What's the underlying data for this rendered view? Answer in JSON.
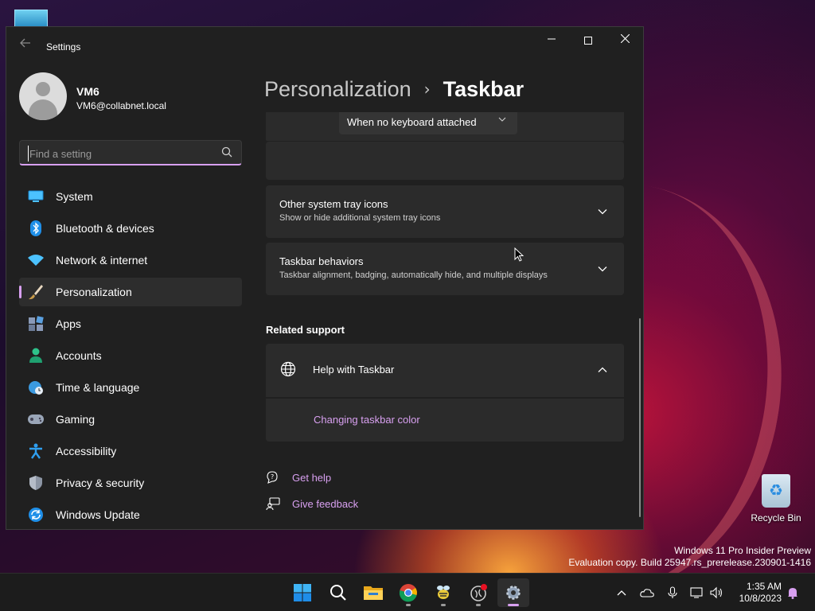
{
  "desktop": {
    "recycle_bin_label": "Recycle Bin",
    "watermark_line1": "Windows 11 Pro Insider Preview",
    "watermark_line2": "Evaluation copy. Build 25947.rs_prerelease.230901-1416"
  },
  "window": {
    "title": "Settings",
    "controls": [
      "minimize",
      "maximize",
      "close"
    ]
  },
  "profile": {
    "name": "VM6",
    "email": "VM6@collabnet.local"
  },
  "search": {
    "placeholder": "Find a setting",
    "value": ""
  },
  "sidebar": {
    "items": [
      {
        "label": "System",
        "icon": "monitor-icon",
        "active": false
      },
      {
        "label": "Bluetooth & devices",
        "icon": "bluetooth-icon",
        "active": false
      },
      {
        "label": "Network & internet",
        "icon": "wifi-icon",
        "active": false
      },
      {
        "label": "Personalization",
        "icon": "brush-icon",
        "active": true
      },
      {
        "label": "Apps",
        "icon": "apps-icon",
        "active": false
      },
      {
        "label": "Accounts",
        "icon": "person-icon",
        "active": false
      },
      {
        "label": "Time & language",
        "icon": "globe-clock-icon",
        "active": false
      },
      {
        "label": "Gaming",
        "icon": "gamepad-icon",
        "active": false
      },
      {
        "label": "Accessibility",
        "icon": "accessibility-icon",
        "active": false
      },
      {
        "label": "Privacy & security",
        "icon": "shield-icon",
        "active": false
      },
      {
        "label": "Windows Update",
        "icon": "update-icon",
        "active": false
      }
    ]
  },
  "breadcrumb": {
    "parent": "Personalization",
    "separator": "›",
    "current": "Taskbar"
  },
  "main": {
    "keyboard_dropdown": {
      "value": "When no keyboard attached"
    },
    "cards": [
      {
        "title": "Other system tray icons",
        "description": "Show or hide additional system tray icons",
        "expanded": false
      },
      {
        "title": "Taskbar behaviors",
        "description": "Taskbar alignment, badging, automatically hide, and multiple displays",
        "expanded": false
      }
    ],
    "related_support": {
      "heading": "Related support",
      "help_title": "Help with Taskbar",
      "help_expanded": true,
      "help_link": "Changing taskbar color"
    },
    "footer_links": {
      "get_help": "Get help",
      "give_feedback": "Give feedback"
    }
  },
  "taskbar": {
    "apps": [
      {
        "name": "start",
        "icon": "windows-start-icon",
        "active": false,
        "running": false
      },
      {
        "name": "search",
        "icon": "search-icon",
        "active": false,
        "running": false
      },
      {
        "name": "file-explorer",
        "icon": "folder-icon",
        "active": false,
        "running": false
      },
      {
        "name": "chrome",
        "icon": "chrome-icon",
        "active": false,
        "running": true
      },
      {
        "name": "app-bee",
        "icon": "bee-app-icon",
        "active": false,
        "running": true
      },
      {
        "name": "app-circle",
        "icon": "circle-app-icon",
        "active": false,
        "running": true
      },
      {
        "name": "settings",
        "icon": "gear-icon",
        "active": true,
        "running": true
      }
    ],
    "clock_time": "1:35 AM",
    "clock_date": "10/8/2023"
  }
}
